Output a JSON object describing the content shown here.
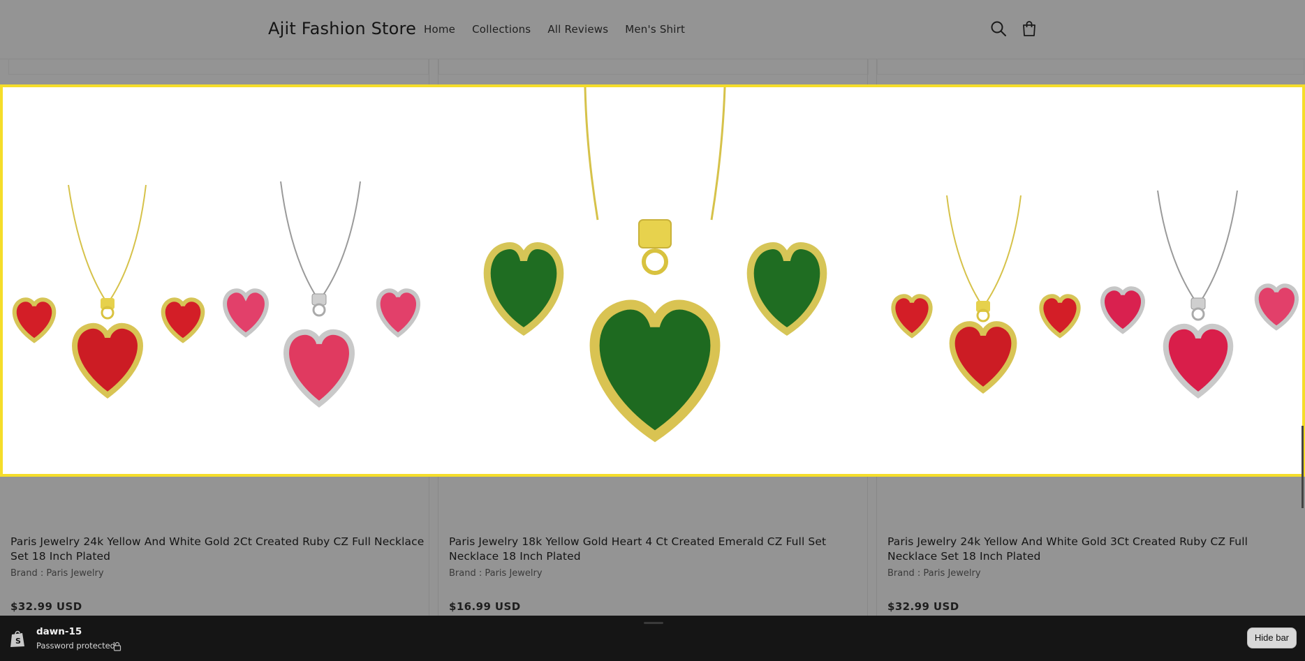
{
  "header": {
    "store_name": "Ajit Fashion Store",
    "nav": [
      "Home",
      "Collections",
      "All Reviews",
      "Men's Shirt"
    ],
    "icons": [
      "search-icon",
      "cart-icon"
    ]
  },
  "products": [
    {
      "title": "Paris Jewelry 24k Yellow And White Gold 2Ct Created Ruby CZ Full Necklace Set 18 Inch Plated",
      "brand": "Brand : Paris Jewelry",
      "price": "$32.99 USD"
    },
    {
      "title": "Paris Jewelry 18k Yellow Gold Heart 4 Ct Created Emerald CZ Full Set Necklace 18 Inch Plated",
      "brand": "Brand : Paris Jewelry",
      "price": "$16.99 USD"
    },
    {
      "title": "Paris Jewelry 24k Yellow And White Gold 3Ct Created Ruby CZ Full Necklace Set 18 Inch Plated",
      "brand": "Brand : Paris Jewelry",
      "price": "$32.99 USD"
    }
  ],
  "admin_bar": {
    "theme_name": "dawn-15",
    "status": "Password protected",
    "hide_button": "Hide bar"
  },
  "colors": {
    "highlight_border": "#f5dd2a",
    "overlay_background": "#949494",
    "admin_bar_background": "#151515"
  }
}
